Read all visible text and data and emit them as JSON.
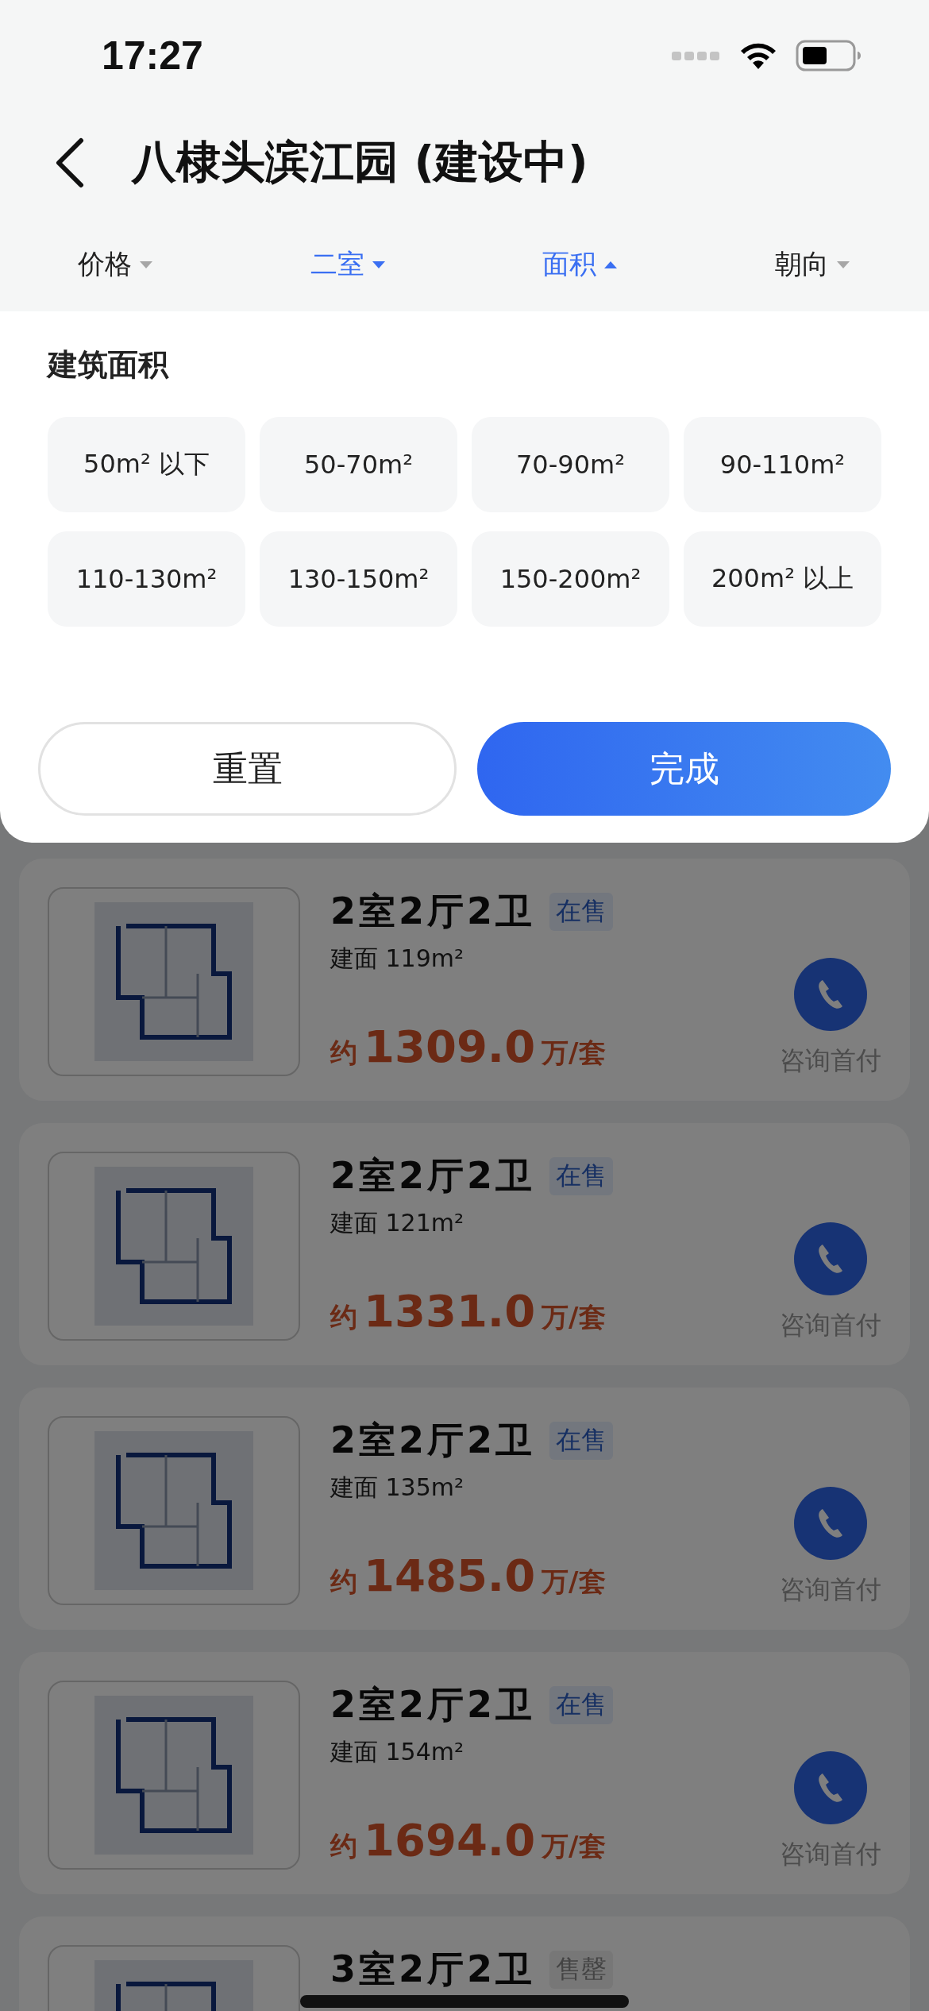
{
  "status_bar": {
    "time": "17:27"
  },
  "header": {
    "title": "八棣头滨江园 (建设中)"
  },
  "filters": [
    {
      "label": "价格",
      "selected": false,
      "expanded": false
    },
    {
      "label": "二室",
      "selected": true,
      "expanded": false
    },
    {
      "label": "面积",
      "selected": true,
      "expanded": true
    },
    {
      "label": "朝向",
      "selected": false,
      "expanded": false
    }
  ],
  "panel": {
    "title": "建筑面积",
    "options": [
      {
        "label": "50m² 以下",
        "selected": false
      },
      {
        "label": "50-70m²",
        "selected": false
      },
      {
        "label": "70-90m²",
        "selected": false
      },
      {
        "label": "90-110m²",
        "selected": false
      },
      {
        "label": "110-130m²",
        "selected": false
      },
      {
        "label": "130-150m²",
        "selected": false
      },
      {
        "label": "150-200m²",
        "selected": false
      },
      {
        "label": "200m² 以上",
        "selected": false
      }
    ],
    "buttons": [
      {
        "label": "重置",
        "kind": "secondary"
      },
      {
        "label": "完成",
        "kind": "primary"
      }
    ]
  },
  "listings": [
    {
      "title": "2室2厅2卫",
      "tag": {
        "label": "在售",
        "kind": "on_sale"
      },
      "area": "建面 119m²",
      "price_prefix": "约",
      "price": "1309.0",
      "price_unit": "万/套",
      "action": "咨询首付"
    },
    {
      "title": "2室2厅2卫",
      "tag": {
        "label": "在售",
        "kind": "on_sale"
      },
      "area": "建面 121m²",
      "price_prefix": "约",
      "price": "1331.0",
      "price_unit": "万/套",
      "action": "咨询首付"
    },
    {
      "title": "2室2厅2卫",
      "tag": {
        "label": "在售",
        "kind": "on_sale"
      },
      "area": "建面 135m²",
      "price_prefix": "约",
      "price": "1485.0",
      "price_unit": "万/套",
      "action": "咨询首付"
    },
    {
      "title": "2室2厅2卫",
      "tag": {
        "label": "在售",
        "kind": "on_sale"
      },
      "area": "建面 154m²",
      "price_prefix": "约",
      "price": "1694.0",
      "price_unit": "万/套",
      "action": "咨询首付"
    },
    {
      "title": "3室2厅2卫",
      "tag": {
        "label": "售罄",
        "kind": "sold_out"
      }
    }
  ]
}
